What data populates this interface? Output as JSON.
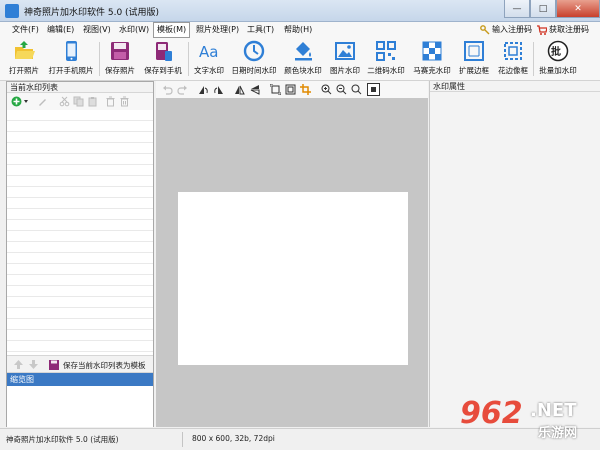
{
  "window": {
    "title": "神奇照片加水印软件 5.0 (试用版)"
  },
  "menu": {
    "items": [
      "文件(F)",
      "编辑(E)",
      "视图(V)",
      "水印(W)",
      "模板(M)",
      "照片处理(P)",
      "工具(T)",
      "帮助(H)"
    ],
    "active": "模板(M)",
    "enter_code": "输入注册码",
    "get_code": "获取注册码"
  },
  "toolbar": {
    "open_photo": "打开照片",
    "open_phone_photo": "打开手机照片",
    "save_photo": "保存照片",
    "save_to_phone": "保存到手机",
    "text_wm": "文字水印",
    "datetime_wm": "日期时间水印",
    "color_block_wm": "颜色块水印",
    "image_wm": "图片水印",
    "qrcode_wm": "二维码水印",
    "mosaic_wm": "马赛克水印",
    "expand_border": "扩展边框",
    "lace_border": "花边像框",
    "batch_wm": "批量加水印"
  },
  "left_panel": {
    "title": "当前水印列表",
    "save_as_template": "保存当前水印列表为模板",
    "thumbnail_title": "缩览图"
  },
  "right_panel": {
    "title": "水印属性"
  },
  "status": {
    "app": "神奇照片加水印软件 5.0 (试用版)",
    "image_info": "800 x 600, 32b, 72dpi"
  },
  "watermark": {
    "number": "962",
    "net": ".NET",
    "site": "乐游网"
  },
  "colors": {
    "thumb_header": "#3b79c4",
    "canvas_bg": "#c6c6c6",
    "accent": "#2f7fd6"
  }
}
